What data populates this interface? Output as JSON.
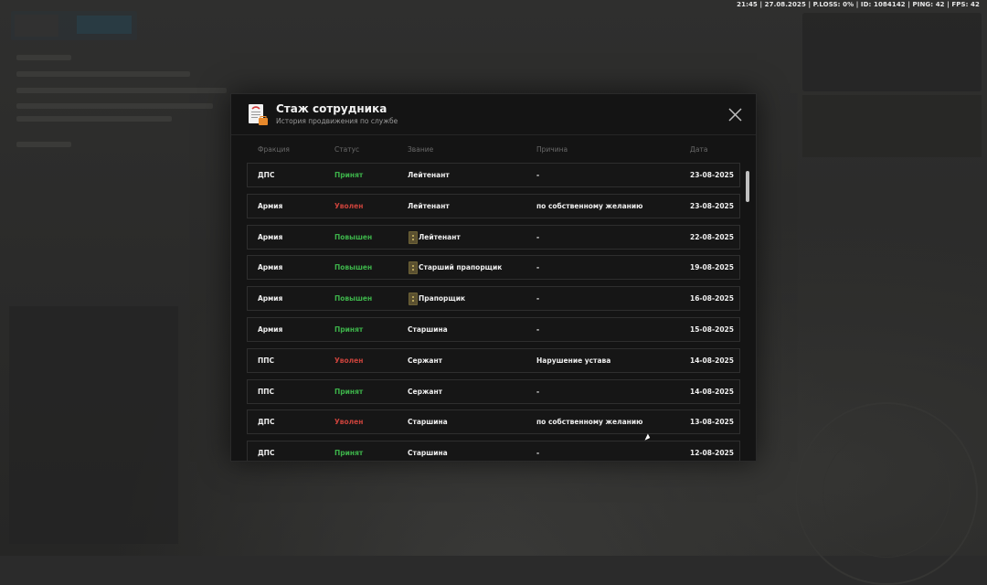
{
  "hud": {
    "status_line": "21:45 | 27.08.2025 | P.LOSS: 0% | ID: 1084142 | PING: 42 | FPS: 42"
  },
  "modal": {
    "title": "Стаж сотрудника",
    "subtitle": "История продвижения по службе",
    "icons": {
      "header": "document-icon",
      "close": "close-icon",
      "rank": "rank-insignia-icon"
    }
  },
  "columns": {
    "faction": "Фракция",
    "status": "Статус",
    "rank": "Звание",
    "reason": "Причина",
    "date": "Дата"
  },
  "colors": {
    "accepted": "#3db34a",
    "fired": "#c9423b",
    "promoted": "#3db34a"
  },
  "rows": [
    {
      "faction": "ДПС",
      "status": "Принят",
      "status_type": "accepted",
      "rank": "Лейтенант",
      "rank_icon": false,
      "reason": "-",
      "date": "23-08-2025"
    },
    {
      "faction": "Армия",
      "status": "Уволен",
      "status_type": "fired",
      "rank": "Лейтенант",
      "rank_icon": false,
      "reason": "по собственному желанию",
      "date": "23-08-2025"
    },
    {
      "faction": "Армия",
      "status": "Повышен",
      "status_type": "promoted",
      "rank": "Лейтенант",
      "rank_icon": true,
      "reason": "-",
      "date": "22-08-2025"
    },
    {
      "faction": "Армия",
      "status": "Повышен",
      "status_type": "promoted",
      "rank": "Старший прапорщик",
      "rank_icon": true,
      "reason": "-",
      "date": "19-08-2025"
    },
    {
      "faction": "Армия",
      "status": "Повышен",
      "status_type": "promoted",
      "rank": "Прапорщик",
      "rank_icon": true,
      "reason": "-",
      "date": "16-08-2025"
    },
    {
      "faction": "Армия",
      "status": "Принят",
      "status_type": "accepted",
      "rank": "Старшина",
      "rank_icon": false,
      "reason": "-",
      "date": "15-08-2025"
    },
    {
      "faction": "ППС",
      "status": "Уволен",
      "status_type": "fired",
      "rank": "Сержант",
      "rank_icon": false,
      "reason": "Нарушение устава",
      "date": "14-08-2025"
    },
    {
      "faction": "ППС",
      "status": "Принят",
      "status_type": "accepted",
      "rank": "Сержант",
      "rank_icon": false,
      "reason": "-",
      "date": "14-08-2025"
    },
    {
      "faction": "ДПС",
      "status": "Уволен",
      "status_type": "fired",
      "rank": "Старшина",
      "rank_icon": false,
      "reason": "по собственному желанию",
      "date": "13-08-2025"
    },
    {
      "faction": "ДПС",
      "status": "Принят",
      "status_type": "accepted",
      "rank": "Старшина",
      "rank_icon": false,
      "reason": "-",
      "date": "12-08-2025"
    }
  ]
}
